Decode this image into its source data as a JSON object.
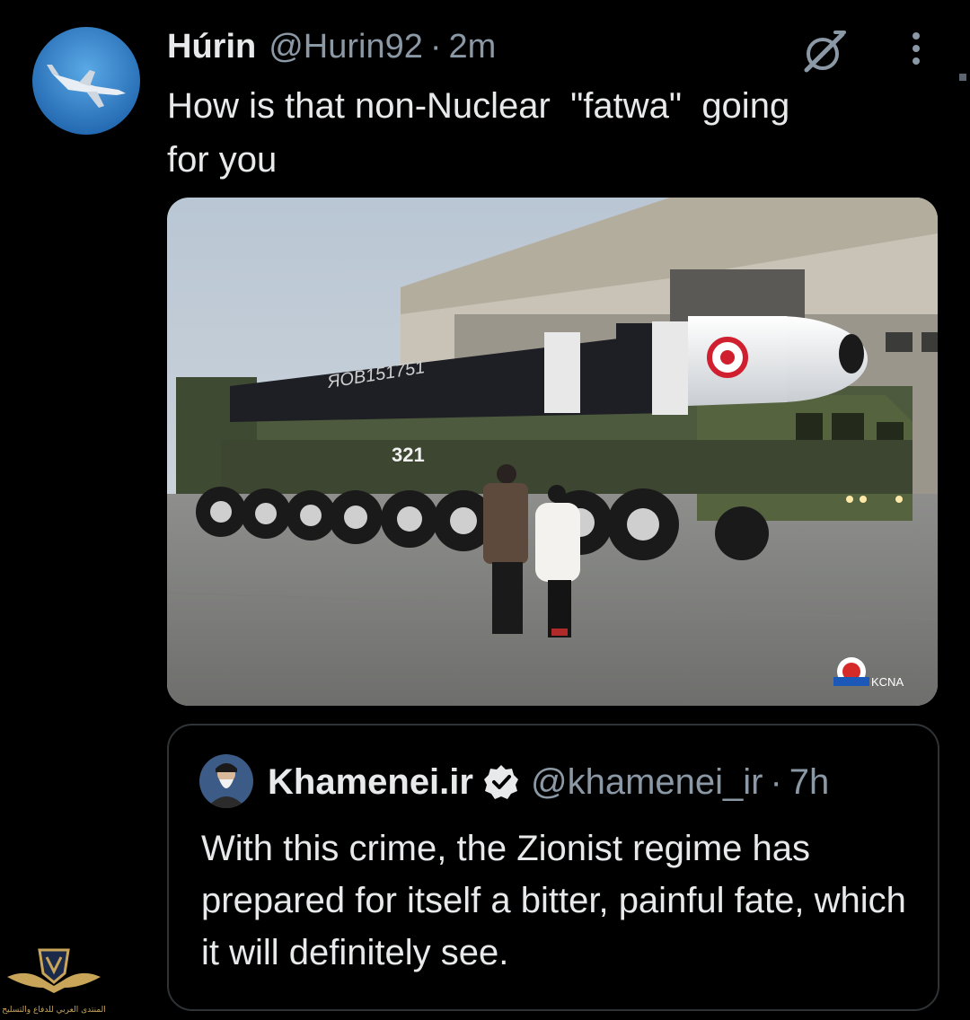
{
  "tweet": {
    "author_name": "Húrin",
    "author_handle": "@Hurin92",
    "separator": "·",
    "timestamp": "2m",
    "text": "How is that non-Nuclear  \"fatwa\"  going\nfor you",
    "media": {
      "missile_marking": "ЯОВ151751",
      "vehicle_number": "321",
      "agency_logo": "KCNA"
    }
  },
  "quoted_tweet": {
    "author_name": "Khamenei.ir",
    "verified": true,
    "author_handle": "@khamenei_ir",
    "separator": "·",
    "timestamp": "7h",
    "text": "With this crime, the Zionist regime has prepared for itself a bitter, painful fate, which it will definitely see."
  },
  "icons": {
    "grok": "grok-icon",
    "more": "more-icon",
    "verified": "verified-badge-icon"
  },
  "colors": {
    "background": "#000000",
    "text": "#e7e9ea",
    "secondary_text": "#8b98a5",
    "border": "#2f3336",
    "verified": "#1d9bf0"
  },
  "watermark": {
    "text": "المنتدى العربي للدفاع والتسليح"
  }
}
